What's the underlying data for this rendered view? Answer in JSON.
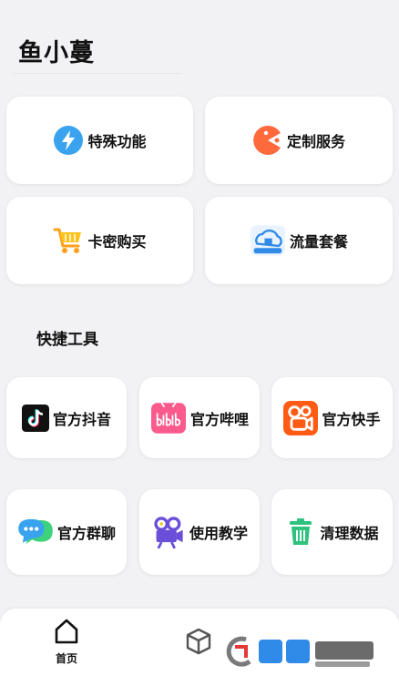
{
  "app": {
    "title": "鱼小蔓"
  },
  "features": [
    {
      "label": "特殊功能",
      "icon": "lightning-icon"
    },
    {
      "label": "定制服务",
      "icon": "pacman-icon"
    },
    {
      "label": "卡密购买",
      "icon": "shopping-cart-icon"
    },
    {
      "label": "流量套餐",
      "icon": "cloud-house-icon"
    }
  ],
  "quick_tools": {
    "title": "快捷工具",
    "items": [
      {
        "label": "官方抖音",
        "icon": "douyin-icon"
      },
      {
        "label": "官方哔哩",
        "icon": "bilibili-icon"
      },
      {
        "label": "官方快手",
        "icon": "kuaishou-icon"
      },
      {
        "label": "官方群聊",
        "icon": "chat-bubble-icon"
      },
      {
        "label": "使用教学",
        "icon": "video-camera-icon"
      },
      {
        "label": "清理数据",
        "icon": "trash-icon"
      }
    ]
  },
  "nav": {
    "home_label": "首页"
  },
  "colors": {
    "accent_blue": "#3aa3ef",
    "accent_orange": "#ff6a3d",
    "accent_green": "#2ec27e",
    "accent_pink": "#fb5a8c",
    "accent_purple": "#6b4fd8"
  }
}
